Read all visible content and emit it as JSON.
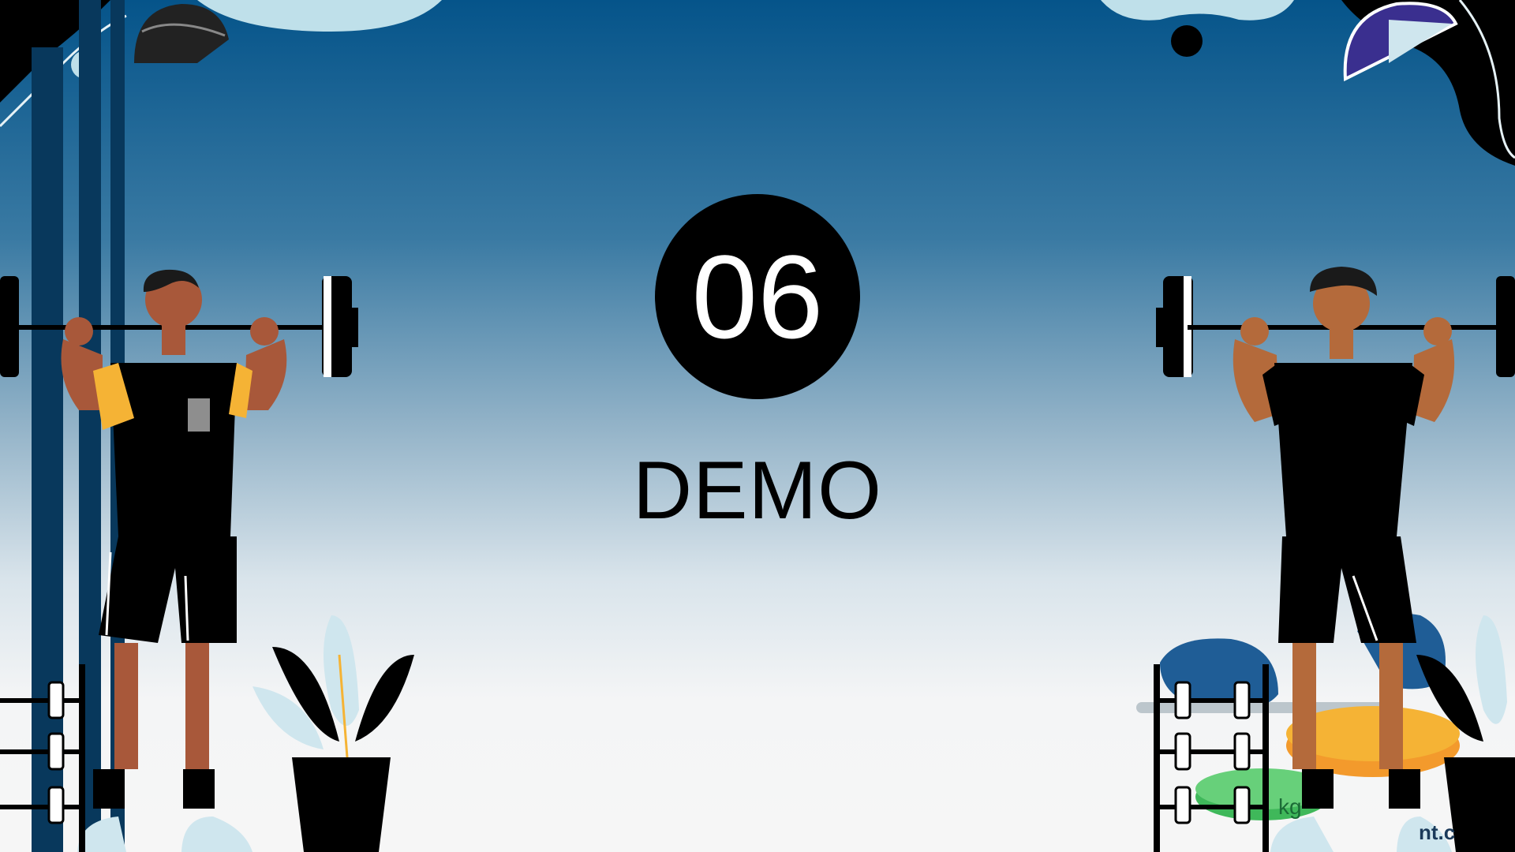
{
  "slide": {
    "number": "06",
    "title": "DEMO",
    "watermark": "nt.c",
    "plate_label": "kg"
  },
  "colors": {
    "background_top": "#05548a",
    "background_bottom": "#f6f6f6",
    "badge": "#000000",
    "badge_text": "#ffffff",
    "title_text": "#000000",
    "accent_yellow": "#f5b335",
    "skin_left": "#a8583a",
    "skin_right": "#b46a3b",
    "light_blue": "#bfe0ea"
  },
  "icons": [
    "barbell-icon",
    "weightlifter-left",
    "weightlifter-right",
    "plant-pot-icon",
    "dumbbell-rack-icon",
    "weight-plate-icon",
    "cap-icon",
    "helmet-icon"
  ]
}
